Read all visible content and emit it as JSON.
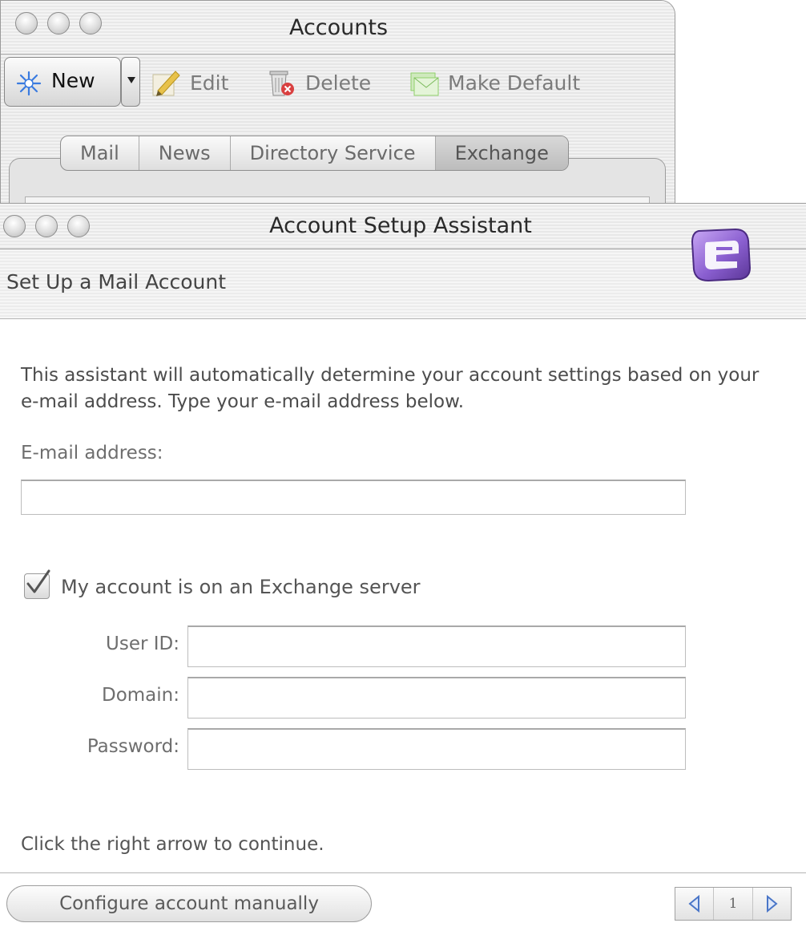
{
  "accounts_window": {
    "title": "Accounts",
    "toolbar": {
      "new_label": "New",
      "edit_label": "Edit",
      "delete_label": "Delete",
      "make_default_label": "Make Default"
    },
    "tabs": [
      {
        "label": "Mail",
        "active": false
      },
      {
        "label": "News",
        "active": false
      },
      {
        "label": "Directory Service",
        "active": false
      },
      {
        "label": "Exchange",
        "active": true
      }
    ]
  },
  "assistant": {
    "window_title": "Account Setup Assistant",
    "header_title": "Set Up a Mail Account",
    "intro_text": "This assistant will automatically determine your account settings based on your e-mail address. Type your e-mail address below.",
    "email": {
      "label": "E-mail address:",
      "value": ""
    },
    "exchange_checkbox": {
      "label": "My account is on an Exchange server",
      "checked": true
    },
    "user_id": {
      "label": "User ID:",
      "value": ""
    },
    "domain": {
      "label": "Domain:",
      "value": ""
    },
    "password": {
      "label": "Password:",
      "value": ""
    },
    "continue_text": "Click the right arrow to continue.",
    "manual_button": "Configure account manually",
    "pager": {
      "page": "1"
    }
  },
  "colors": {
    "accent_purple": "#8a5fd0",
    "new_star_blue": "#3a7be0",
    "edit_icon_yellow": "#e8c24a",
    "delete_icon_red": "#d94040",
    "default_icon_green": "#8fcf6a",
    "pager_arrow_blue": "#4a76c8"
  },
  "icons": {
    "new": "star-burst-icon",
    "edit": "pencil-paper-icon",
    "delete": "trash-can-icon",
    "make_default": "mail-stack-icon",
    "logo": "entourage-logo-icon",
    "check": "checkmark-icon",
    "prev": "left-arrow-icon",
    "next": "right-arrow-icon"
  }
}
